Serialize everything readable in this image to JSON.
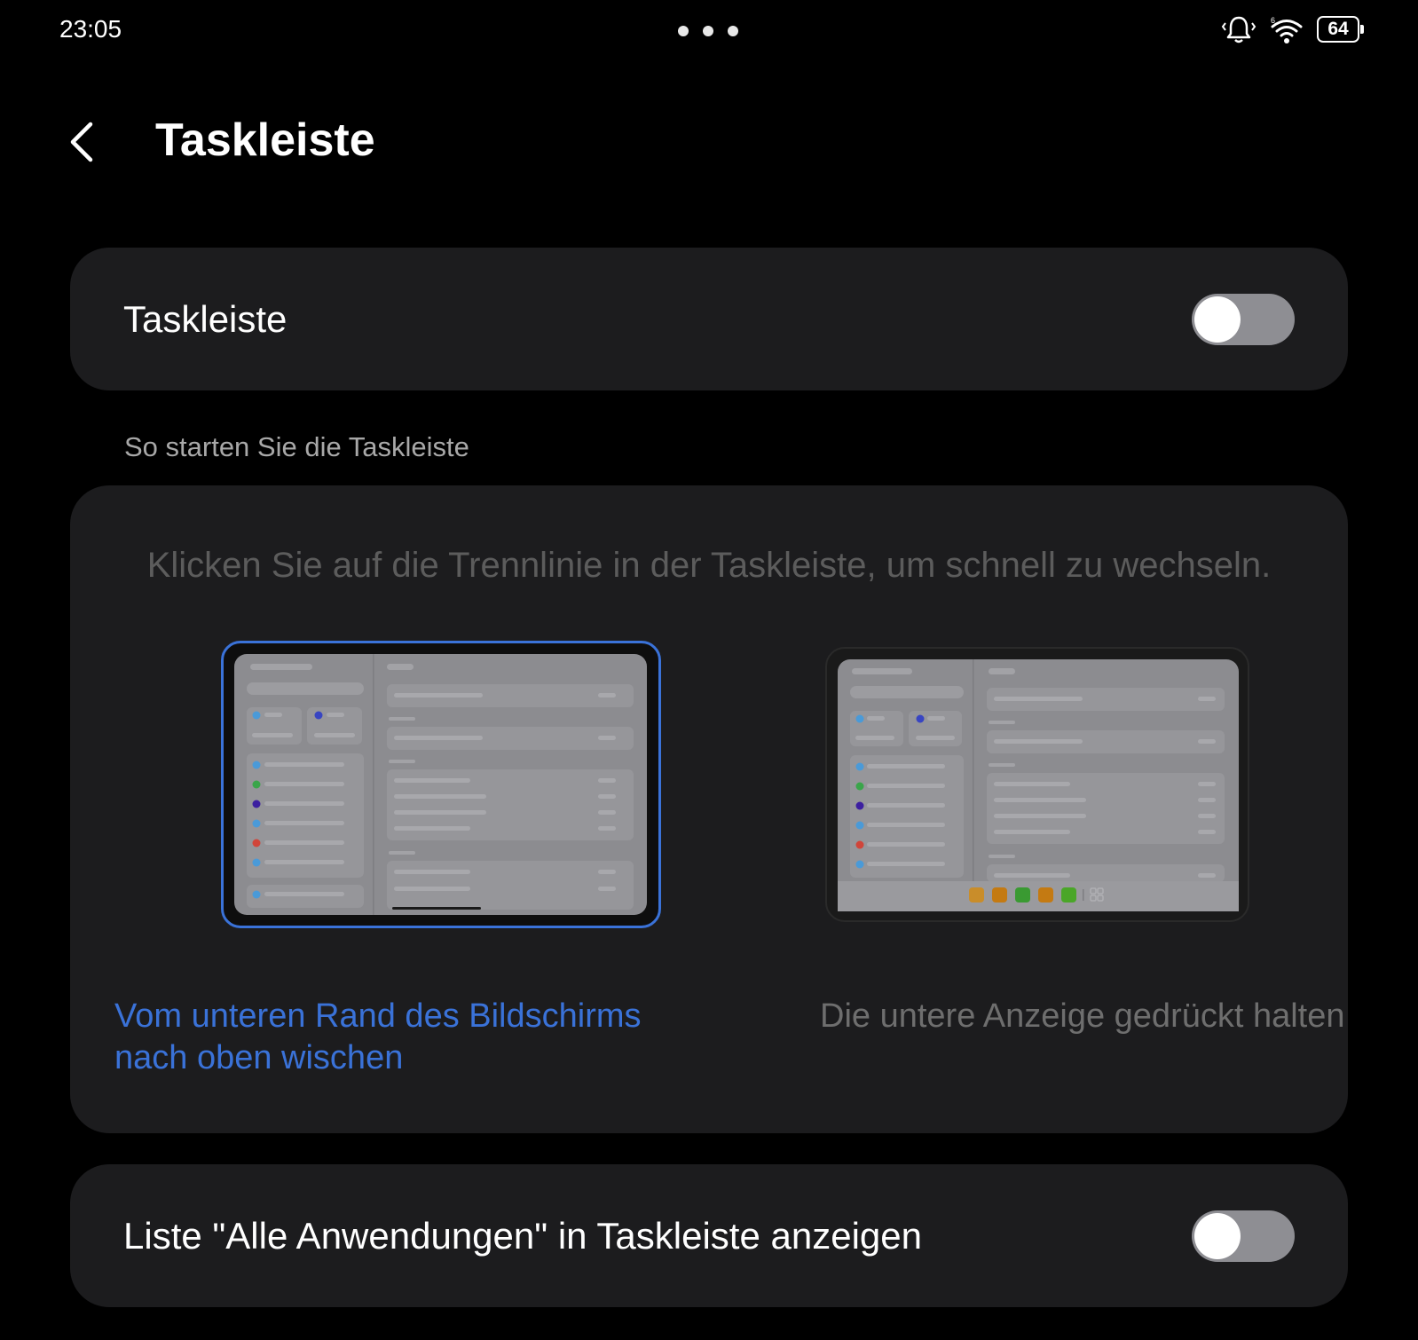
{
  "status_bar": {
    "time": "23:05",
    "battery": "64",
    "icons": [
      "notification-bell-icon",
      "wifi-icon",
      "battery-icon"
    ]
  },
  "header": {
    "title": "Taskleiste",
    "back_icon": "chevron-left-icon"
  },
  "taskbar_toggle": {
    "label": "Taskleiste",
    "enabled": false
  },
  "howto": {
    "section_title": "So starten Sie die Taskleiste",
    "description": "Klicken Sie auf die Trennlinie in der Taskleiste, um schnell zu wechseln.",
    "options": [
      {
        "label": "Vom unteren Rand des Bildschirms nach oben wischen",
        "selected": true
      },
      {
        "label": "Die untere Anzeige gedrückt halten",
        "selected": false
      }
    ]
  },
  "all_apps_toggle": {
    "label": "Liste \"Alle Anwendungen\" in Taskleiste anzeigen",
    "enabled": false
  },
  "colors": {
    "background": "#000000",
    "card": "#1c1c1e",
    "accent": "#3a72d8",
    "toggle_off": "#8e8e93"
  }
}
